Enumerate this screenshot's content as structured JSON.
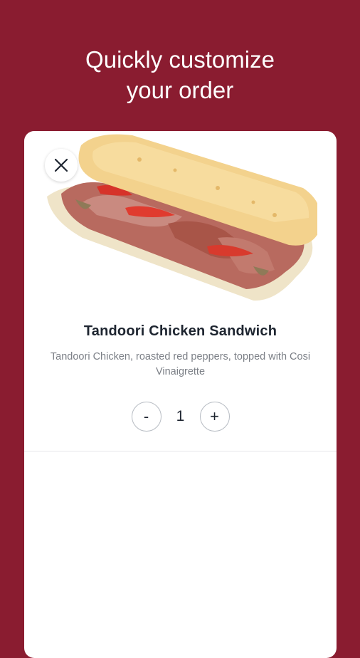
{
  "headline": {
    "line1": "Quickly customize",
    "line2": "your order"
  },
  "item": {
    "name": "Tandoori Chicken Sandwich",
    "description": "Tandoori Chicken, roasted red peppers, topped with Cosi Vinaigrette"
  },
  "quantity": {
    "decrement_label": "-",
    "value": "1",
    "increment_label": "+"
  },
  "icons": {
    "close": "close-icon",
    "image": "sandwich-image"
  },
  "colors": {
    "background": "#8a1c30",
    "card": "#ffffff",
    "text_primary": "#1e2530",
    "text_secondary": "#7b7f86"
  }
}
